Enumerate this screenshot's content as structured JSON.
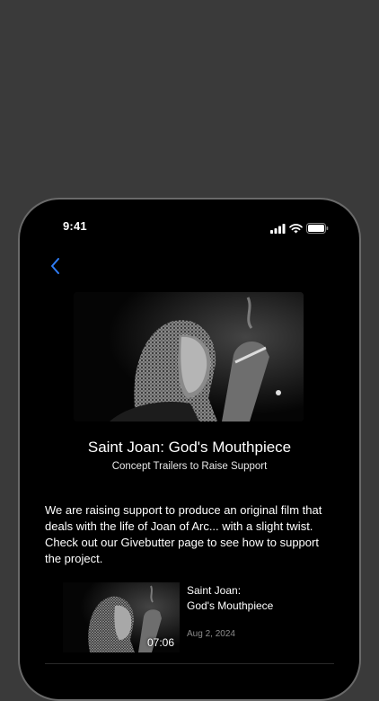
{
  "status_bar": {
    "time": "9:41"
  },
  "nav": {
    "back_icon": "chevron-left-icon",
    "accent_color": "#2f7df6"
  },
  "header": {
    "title": "Saint Joan: God's Mouthpiece",
    "subtitle": "Concept Trailers to Raise Support"
  },
  "description": "We are raising support to produce an original film that deals with the life of Joan of Arc... with a slight twist. Check out our Givebutter page to see how to support the project.",
  "videos": [
    {
      "title": "Saint Joan:\nGod's Mouthpiece",
      "duration": "07:06",
      "date": "Aug 2, 2024"
    }
  ]
}
